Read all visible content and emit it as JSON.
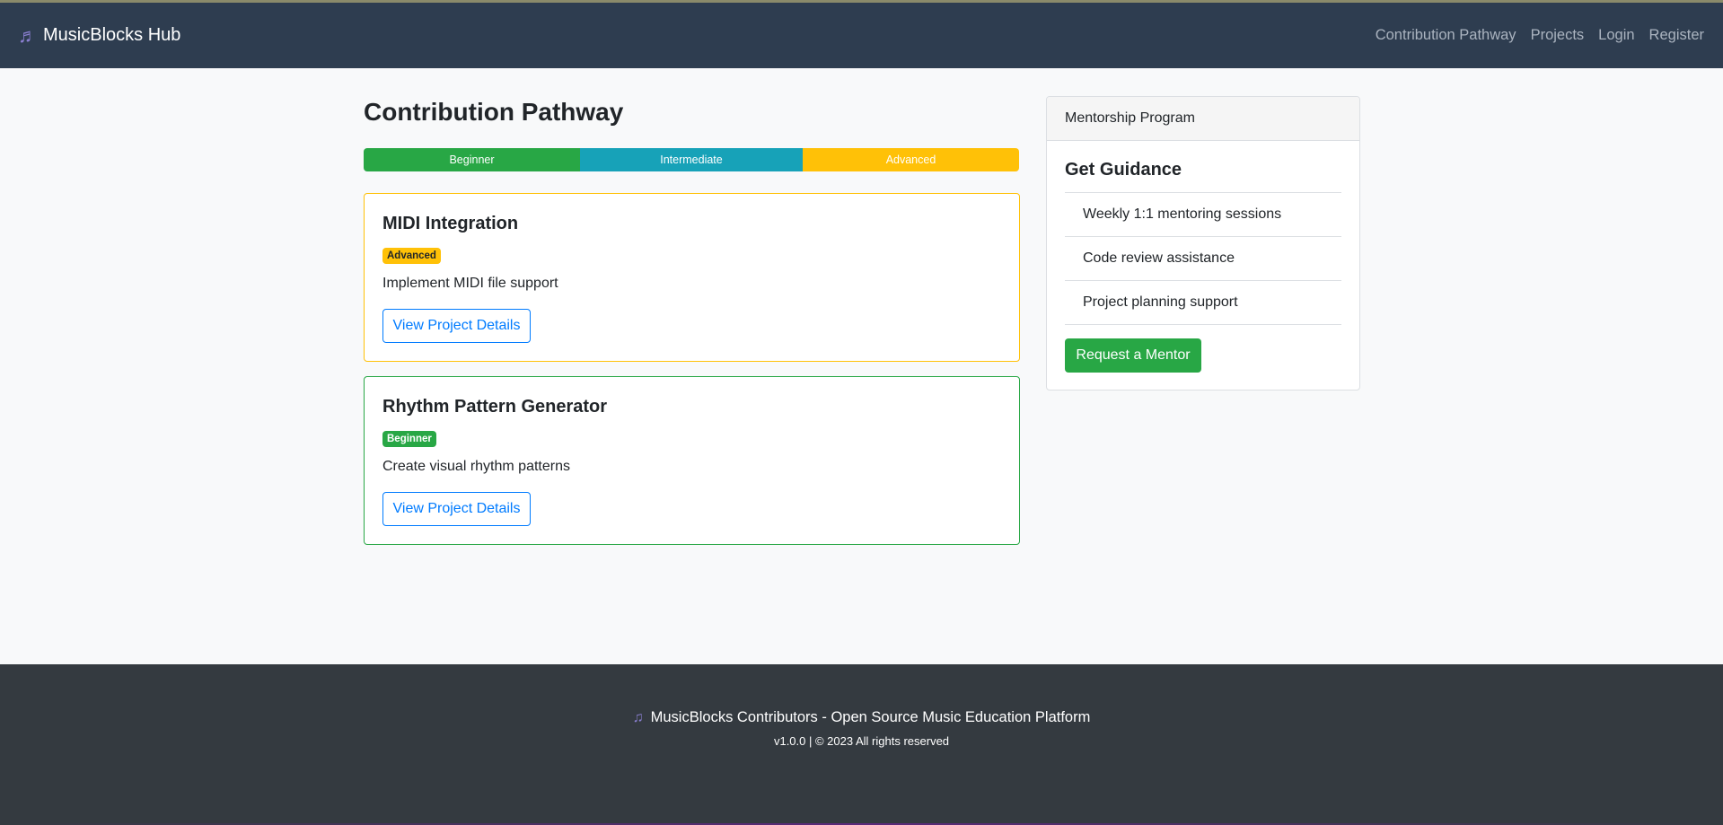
{
  "colors": {
    "navbar_bg": "#2e3d50",
    "beginner": "#28a745",
    "intermediate": "#17a2b8",
    "advanced": "#ffc107",
    "primary": "#007bff",
    "footer_bg": "#343a40",
    "brand_icon": "#8a7fd0"
  },
  "navbar": {
    "brand_icon": "music-note-icon",
    "brand": "MusicBlocks Hub",
    "links": [
      "Contribution Pathway",
      "Projects",
      "Login",
      "Register"
    ]
  },
  "main": {
    "title": "Contribution Pathway",
    "pathway": [
      "Beginner",
      "Intermediate",
      "Advanced"
    ],
    "projects": [
      {
        "title": "MIDI Integration",
        "level": "Advanced",
        "description": "Implement MIDI file support",
        "button": "View Project Details"
      },
      {
        "title": "Rhythm Pattern Generator",
        "level": "Beginner",
        "description": "Create visual rhythm patterns",
        "button": "View Project Details"
      }
    ]
  },
  "sidebar": {
    "header": "Mentorship Program",
    "title": "Get Guidance",
    "items": [
      "Weekly 1:1 mentoring sessions",
      "Code review assistance",
      "Project planning support"
    ],
    "button": "Request a Mentor"
  },
  "footer": {
    "icon": "music-notes-icon",
    "text": "MusicBlocks Contributors - Open Source Music Education Platform",
    "sub": "v1.0.0 | © 2023 All rights reserved"
  }
}
